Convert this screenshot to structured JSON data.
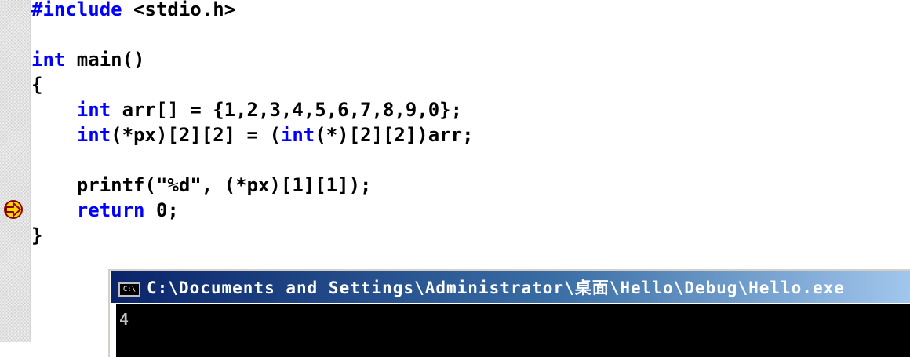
{
  "editor": {
    "lines": [
      {
        "segments": [
          {
            "text": "#include",
            "cls": "pp"
          },
          {
            "text": " <stdio.h>"
          }
        ]
      },
      {
        "segments": []
      },
      {
        "segments": [
          {
            "text": "int",
            "cls": "kw"
          },
          {
            "text": " main()"
          }
        ]
      },
      {
        "segments": [
          {
            "text": "{"
          }
        ]
      },
      {
        "segments": [
          {
            "text": "    "
          },
          {
            "text": "int",
            "cls": "kw"
          },
          {
            "text": " arr[] = {1,2,3,4,5,6,7,8,9,0};"
          }
        ]
      },
      {
        "segments": [
          {
            "text": "    "
          },
          {
            "text": "int",
            "cls": "kw"
          },
          {
            "text": "(*px)[2][2] = ("
          },
          {
            "text": "int",
            "cls": "kw"
          },
          {
            "text": "(*)[2][2])arr;"
          }
        ]
      },
      {
        "segments": []
      },
      {
        "segments": [
          {
            "text": "    printf(\"%d\", (*px)[1][1]);"
          }
        ]
      },
      {
        "segments": [
          {
            "text": "    "
          },
          {
            "text": "return",
            "cls": "kw"
          },
          {
            "text": " 0;"
          }
        ]
      },
      {
        "segments": [
          {
            "text": "}"
          }
        ]
      }
    ],
    "current_line_index": 8,
    "keyword_color": "#0000ff"
  },
  "gutter": {
    "marker_icon": "current-execution-arrow-icon"
  },
  "console": {
    "icon": "console-icon",
    "icon_text": "C:\\",
    "title": "C:\\Documents and Settings\\Administrator\\桌面\\Hello\\Debug\\Hello.exe",
    "output": "4"
  }
}
